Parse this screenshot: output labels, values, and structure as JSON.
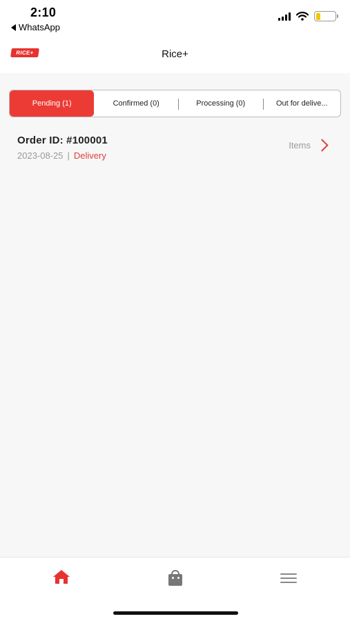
{
  "status_bar": {
    "time": "2:10",
    "back_app": "WhatsApp",
    "battery_level": 0.25,
    "battery_color": "#f2c700"
  },
  "header": {
    "logo_text": "RICE+",
    "title": "Rice+"
  },
  "tabs": [
    {
      "label": "Pending (1)",
      "active": true
    },
    {
      "label": "Confirmed (0)",
      "active": false
    },
    {
      "label": "Processing (0)",
      "active": false
    },
    {
      "label": "Out for delive...",
      "active": false
    }
  ],
  "orders": [
    {
      "id_label": "Order ID: #100001",
      "date": "2023-08-25",
      "separator": "|",
      "type": "Delivery",
      "items_label": "Items"
    }
  ],
  "bottom_nav": [
    {
      "icon": "home-icon",
      "active": true
    },
    {
      "icon": "bag-icon",
      "active": false
    },
    {
      "icon": "menu-icon",
      "active": false
    }
  ],
  "colors": {
    "accent": "#ec3b35",
    "muted_text": "#999999",
    "background": "#f7f7f7"
  }
}
